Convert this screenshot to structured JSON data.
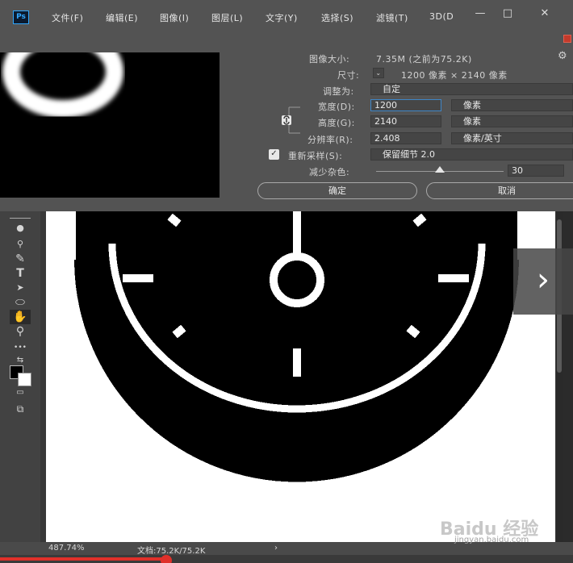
{
  "app": {
    "logo": "Ps"
  },
  "menu": [
    "文件(F)",
    "编辑(E)",
    "图像(I)",
    "图层(L)",
    "文字(Y)",
    "选择(S)",
    "滤镜(T)",
    "3D(D"
  ],
  "window_controls": {
    "minimize": "—",
    "restore": "□",
    "close": "✕"
  },
  "dialog": {
    "image_size_label": "图像大小:",
    "image_size_value": "7.35M (之前为75.2K)",
    "dimensions_label": "尺寸:",
    "dimensions_value": "1200 像素 × 2140 像素",
    "fit_label": "调整为:",
    "fit_value": "自定",
    "width_label": "宽度(D):",
    "width_value": "1200",
    "width_unit": "像素",
    "height_label": "高度(G):",
    "height_value": "2140",
    "height_unit": "像素",
    "resolution_label": "分辨率(R):",
    "resolution_value": "2.408",
    "resolution_unit": "像素/英寸",
    "resample_label": "重新采样(S):",
    "resample_checked": true,
    "resample_value": "保留细节 2.0",
    "noise_label": "减少杂色:",
    "noise_value": "30",
    "noise_level": 0.5,
    "ok_label": "确定",
    "cancel_label": "取消"
  },
  "tools": {
    "items": [
      {
        "name": "pen-tool-icon",
        "glyph": "✎"
      },
      {
        "name": "type-tool-icon",
        "glyph": "T"
      },
      {
        "name": "path-select-tool-icon",
        "glyph": "➤"
      },
      {
        "name": "shape-tool-icon",
        "glyph": "⬭"
      },
      {
        "name": "hand-tool-icon",
        "glyph": "✋"
      },
      {
        "name": "zoom-tool-icon",
        "glyph": "⚲"
      },
      {
        "name": "more-tools-icon",
        "glyph": "•••"
      }
    ]
  },
  "status": {
    "zoom": "487.74%",
    "doc_info": "文档:75.2K/75.2K"
  },
  "video": {
    "progress": 0.29
  },
  "watermark": {
    "brand": "Baidu 经验",
    "url": "jingyan.baidu.com"
  }
}
